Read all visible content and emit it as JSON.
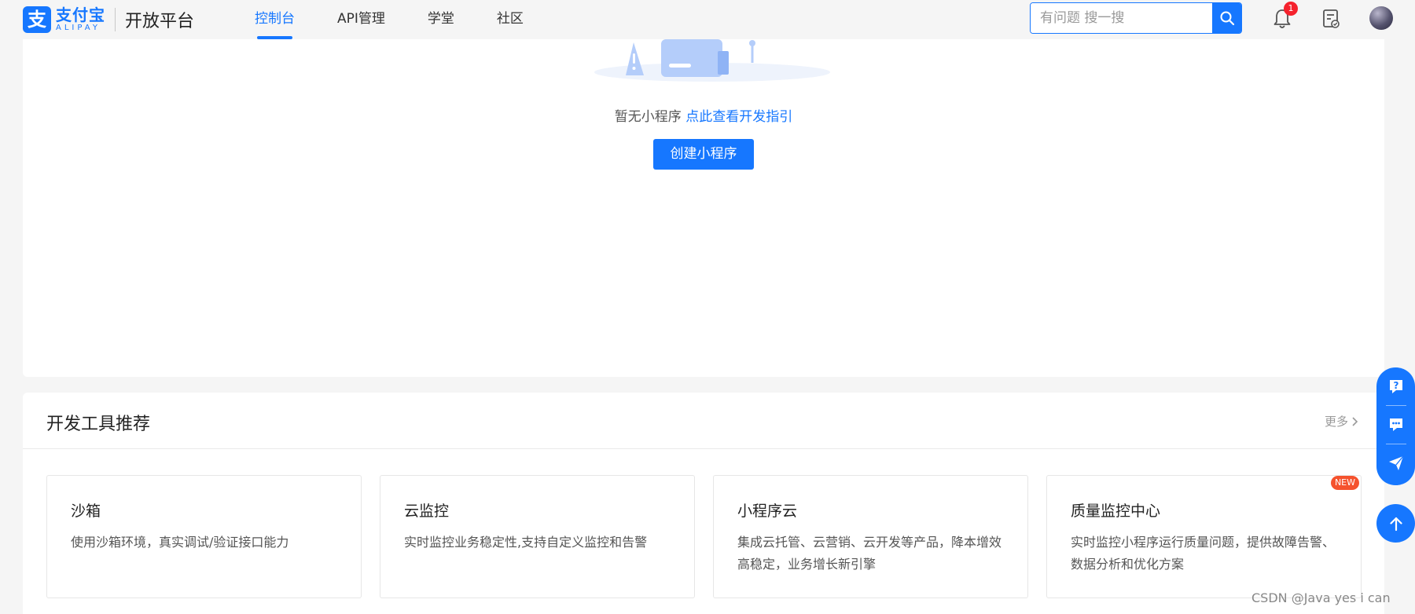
{
  "header": {
    "logo": {
      "mark": "支",
      "cn": "支付宝",
      "en": "ALIPAY"
    },
    "platform_name": "开放平台",
    "nav": [
      {
        "label": "控制台",
        "active": true
      },
      {
        "label": "API管理",
        "active": false
      },
      {
        "label": "学堂",
        "active": false
      },
      {
        "label": "社区",
        "active": false
      }
    ],
    "search": {
      "placeholder": "有问题 搜一搜",
      "value": ""
    },
    "notification_count": "1"
  },
  "empty_state": {
    "text": "暂无小程序",
    "link": "点此查看开发指引",
    "create_button": "创建小程序"
  },
  "tools_section": {
    "title": "开发工具推荐",
    "more_label": "更多",
    "tools": [
      {
        "name": "沙箱",
        "desc": "使用沙箱环境，真实调试/验证接口能力",
        "badge": ""
      },
      {
        "name": "云监控",
        "desc": "实时监控业务稳定性,支持自定义监控和告警",
        "badge": ""
      },
      {
        "name": "小程序云",
        "desc": "集成云托管、云营销、云开发等产品，降本增效高稳定，业务增长新引擎",
        "badge": ""
      },
      {
        "name": "质量监控中心",
        "desc": "实时监控小程序运行质量问题，提供故障告警、数据分析和优化方案",
        "badge": "NEW"
      }
    ]
  },
  "watermark": "CSDN @Java yes i can",
  "colors": {
    "primary": "#1677ff",
    "badge_red": "#f5222d",
    "new_badge": "#f5522d",
    "page_bg": "#f5f5f5"
  },
  "icons": [
    "search-icon",
    "bell-icon",
    "doc-check-icon",
    "help-icon",
    "chat-icon",
    "feedback-icon",
    "arrow-up-icon",
    "chevron-right-icon"
  ]
}
